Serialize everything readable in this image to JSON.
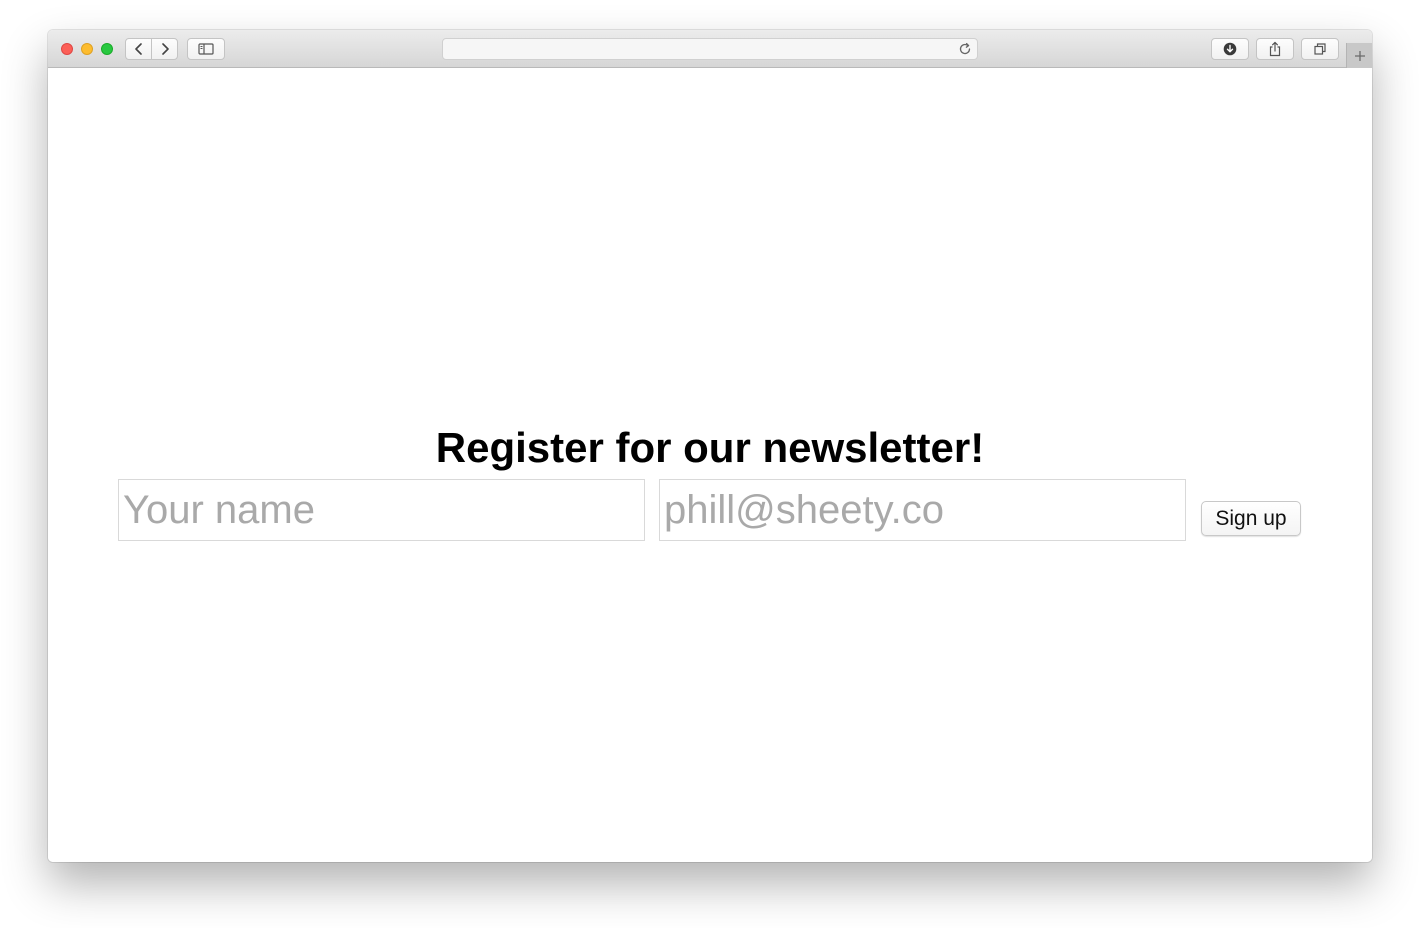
{
  "browser": {
    "address_text": "",
    "icons": {
      "back": "chevron-left-icon",
      "forward": "chevron-right-icon",
      "sidebar": "sidebar-icon",
      "reload": "reload-icon",
      "download": "download-icon",
      "share": "share-icon",
      "tabs": "tabs-overview-icon",
      "new_tab": "plus-icon"
    }
  },
  "page": {
    "heading": "Register for our newsletter!",
    "name_field": {
      "value": "",
      "placeholder": "Your name"
    },
    "email_field": {
      "value": "",
      "placeholder": "phill@sheety.co"
    },
    "signup_label": "Sign up"
  },
  "colors": {
    "traffic_close": "#fc5f57",
    "traffic_minimize": "#fdbc2e",
    "traffic_maximize": "#28c840",
    "placeholder": "#a9a9a9"
  }
}
